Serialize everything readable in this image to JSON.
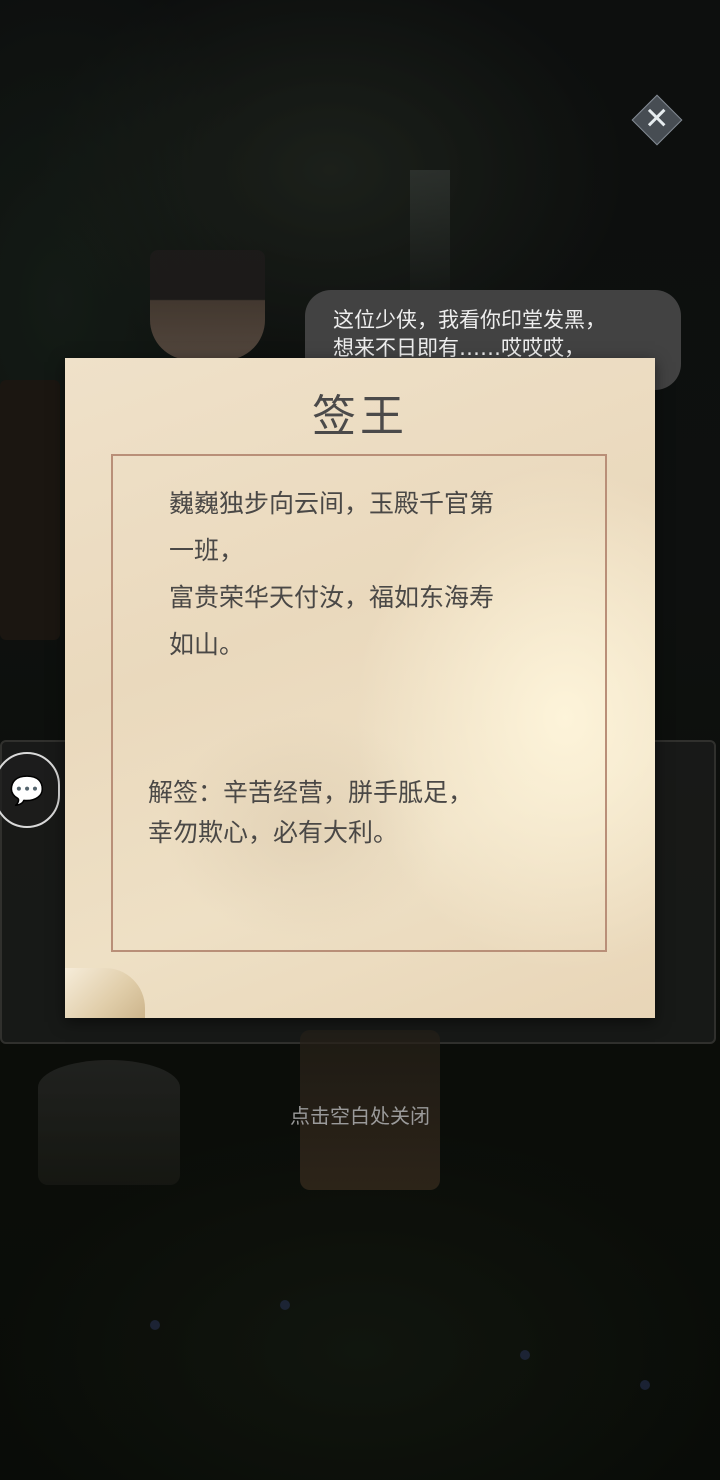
{
  "dialogue": {
    "line1": "这位少侠，我看你印堂发黑，",
    "line2": "想来不日即有……哎哎哎，"
  },
  "fortune": {
    "title": "签王",
    "poem_lines": [
      "巍巍独步向云间，玉殿千官第",
      "一班，",
      "富贵荣华天付汝，福如东海寿",
      "如山。"
    ],
    "interpretation_lines": [
      "解签：辛苦经营，胼手胝足，",
      "幸勿欺心，必有大利。"
    ]
  },
  "hint": "点击空白处关闭",
  "icons": {
    "close": "close-icon",
    "chat": "chat-bubble-icon"
  },
  "colors": {
    "paper": "#ede0c7",
    "frame": "#b98f78",
    "text": "#4a4846"
  }
}
